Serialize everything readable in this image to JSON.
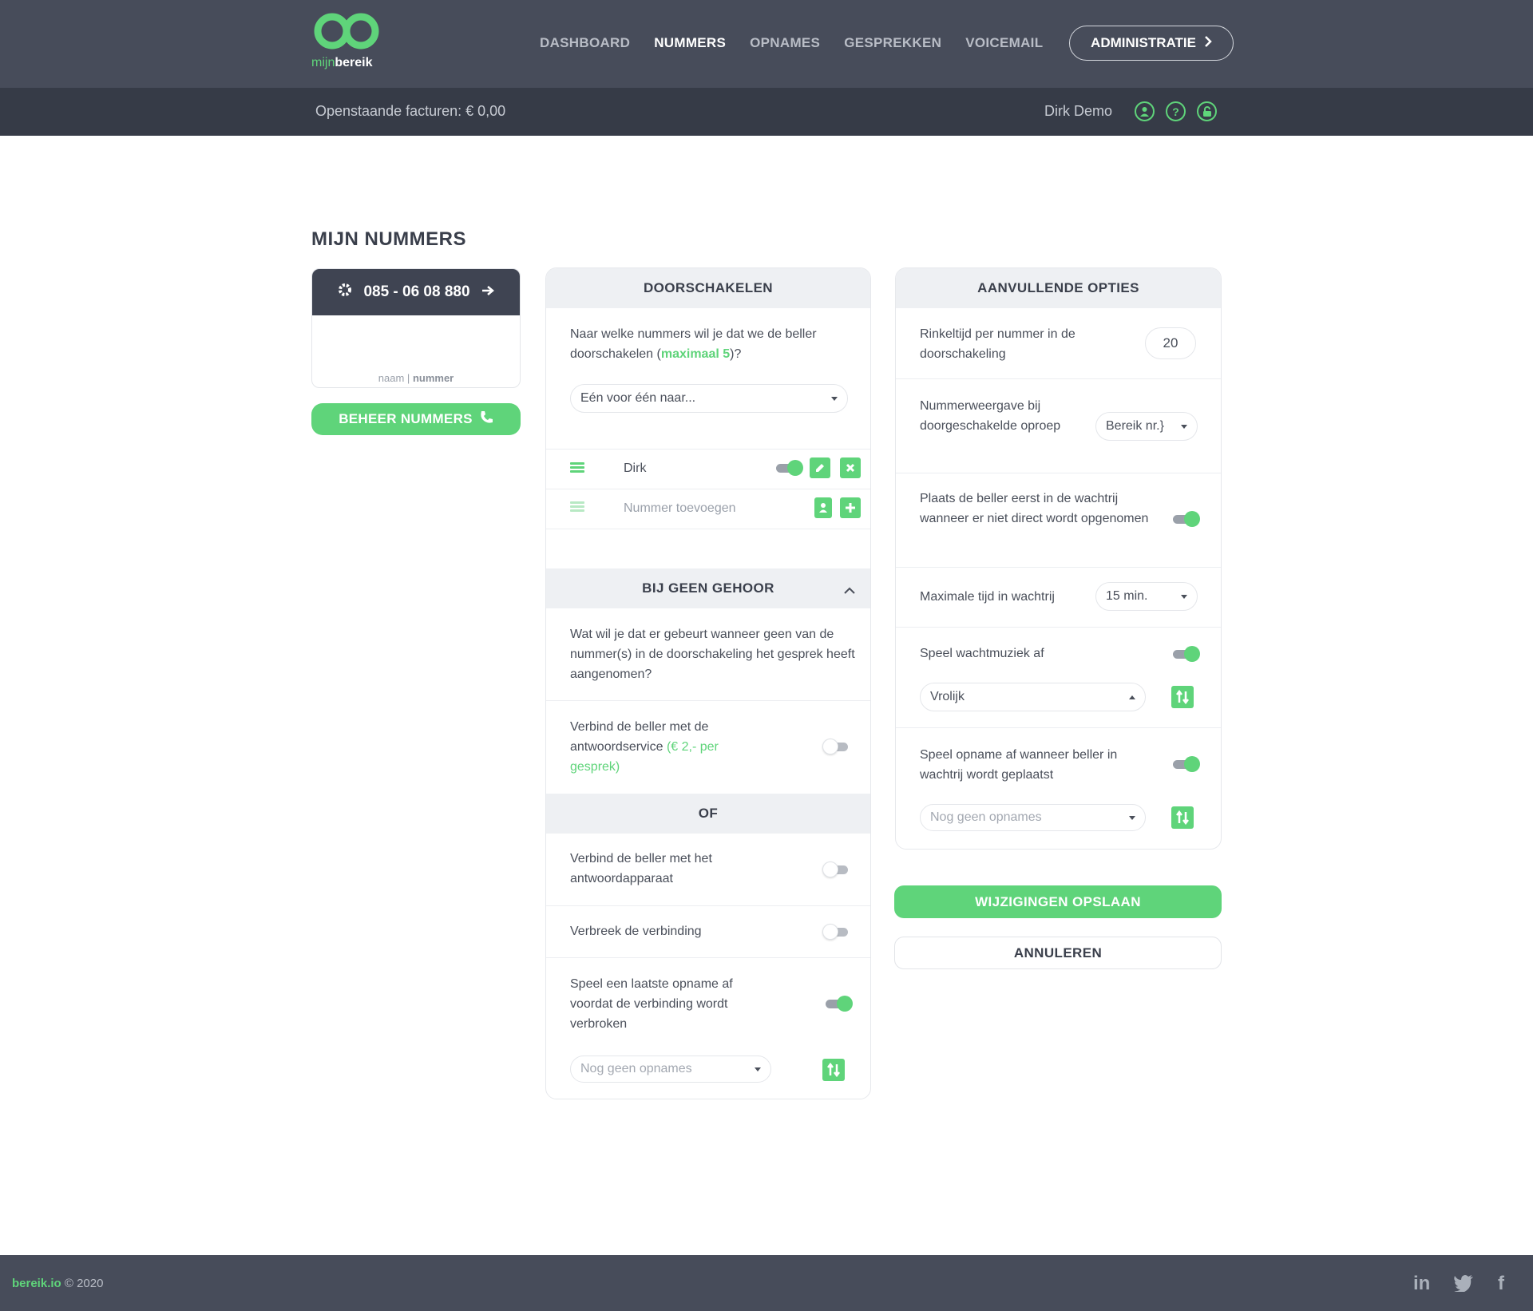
{
  "brand": {
    "logo_part1": "mijn",
    "logo_part2": "bereik"
  },
  "nav": {
    "links": [
      "DASHBOARD",
      "NUMMERS",
      "OPNAMES",
      "GESPREKKEN",
      "VOICEMAIL"
    ],
    "active": "NUMMERS",
    "admin_label": "ADMINISTRATIE"
  },
  "subnav": {
    "invoices": "Openstaande facturen: € 0,00",
    "user": "Dirk Demo"
  },
  "page": {
    "title": "MIJN NUMMERS"
  },
  "number_card": {
    "number": "085 - 06 08 880",
    "sub_name": "naam",
    "sub_sep": "|",
    "sub_number": "nummer"
  },
  "beheer_label": "BEHEER NUMMERS",
  "forward": {
    "title": "DOORSCHAKELEN",
    "question_a": "Naar welke nummers wil je dat we de beller doorschakelen (",
    "question_max": "maximaal 5",
    "question_b": ")?",
    "mode": "Eén voor één naar...",
    "entries": [
      {
        "name": "Dirk",
        "enabled": true
      }
    ],
    "add_placeholder": "Nummer toevoegen"
  },
  "no_answer": {
    "title": "BIJ GEEN GEHOOR",
    "question": "Wat wil je dat er gebeurt wanneer geen van de nummer(s) in de doorschakeling het gesprek heeft aangenomen?",
    "service_label_a": "Verbind de beller met de antwoordservice",
    "service_label_price": "(€ 2,- per gesprek)",
    "service_on": false,
    "or_label": "OF",
    "voicemail_label": "Verbind de beller met het antwoordapparaat",
    "voicemail_on": false,
    "hangup_label": "Verbreek de verbinding",
    "hangup_on": false,
    "last_recording_label": "Speel een laatste opname af voordat de verbinding wordt verbroken",
    "last_recording_on": true,
    "last_recording_select": "Nog geen opnames"
  },
  "extra": {
    "title": "AANVULLENDE OPTIES",
    "ring_label": "Rinkeltijd per nummer in de doorschakeling",
    "ring_value": "20",
    "display_label": "Nummerweergave bij doorgeschakelde oproep",
    "display_value": "Bereik nr.",
    "queue_label": "Plaats de beller eerst in de wachtrij wanneer er niet direct wordt opgenomen",
    "queue_on": true,
    "max_wait_label": "Maximale tijd in wachtrij",
    "max_wait_value": "15 min.",
    "music_label": "Speel wachtmuziek af",
    "music_on": true,
    "music_value": "Vrolijk",
    "queue_recording_label": "Speel opname af wanneer beller in wachtrij wordt geplaatst",
    "queue_recording_on": true,
    "queue_recording_select": "Nog geen opnames"
  },
  "actions": {
    "save": "WIJZIGINGEN OPSLAAN",
    "cancel": "ANNULEREN"
  },
  "footer": {
    "brand": "bereik.io",
    "copyright": "© 2020",
    "social": [
      "linkedin-icon",
      "twitter-icon",
      "facebook-icon"
    ]
  },
  "colors": {
    "accent": "#5fd47a",
    "nav_bg": "#474c5a",
    "subnav_bg": "#363b47",
    "text": "#3a3f4b"
  }
}
